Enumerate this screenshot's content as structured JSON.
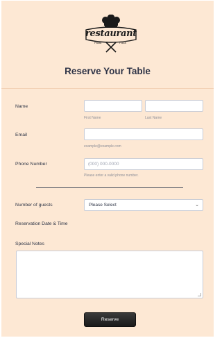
{
  "form": {
    "title": "Reserve Your Table",
    "logo": {
      "text": "restaurant",
      "left_word": "Pasta",
      "right_word": "Pizza"
    },
    "name": {
      "label": "Name",
      "first_sublabel": "First Name",
      "last_sublabel": "Last Name"
    },
    "email": {
      "label": "Email",
      "sublabel": "example@example.com"
    },
    "phone": {
      "label": "Phone Number",
      "placeholder": "(000) 000-0000",
      "sublabel": "Please enter a valid phone number."
    },
    "guests": {
      "label": "Number of guests",
      "selected": "Please Select"
    },
    "datetime": {
      "label": "Reservation Date & Time"
    },
    "notes": {
      "label": "Special Notes"
    },
    "submit": {
      "label": "Reserve"
    }
  },
  "colors": {
    "background": "#fde8d4",
    "button": "#222222",
    "text": "#2c3345"
  }
}
